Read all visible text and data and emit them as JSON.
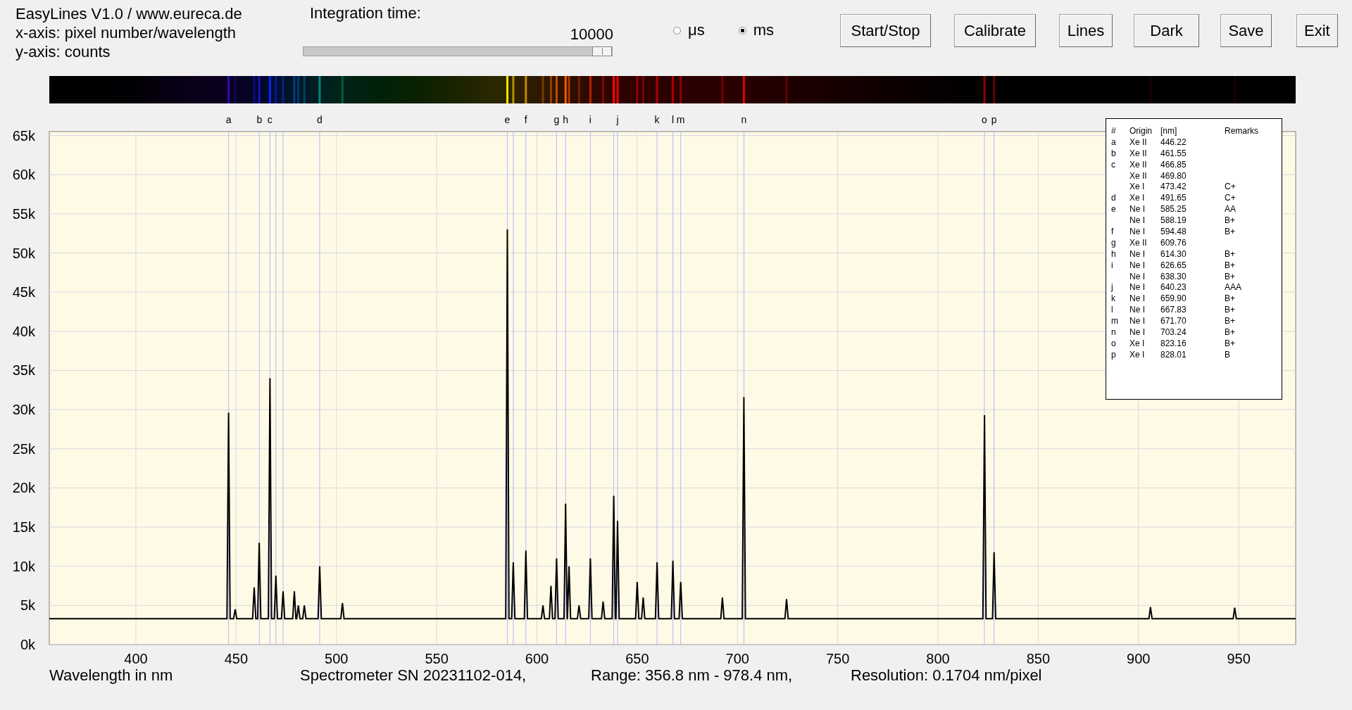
{
  "header": {
    "info_lines": [
      "EasyLines V1.0 / www.eureca.de",
      "x-axis: pixel number/wavelength",
      "y-axis: counts"
    ],
    "integration": {
      "label": "Integration time:",
      "value": "10000",
      "level": 1.0
    },
    "units": [
      {
        "label": "μs",
        "selected": false
      },
      {
        "label": "ms",
        "selected": true
      }
    ],
    "buttons": [
      "Start/Stop",
      "Calibrate",
      "Lines",
      "Dark",
      "Save",
      "Exit"
    ]
  },
  "chart_data": {
    "type": "line",
    "xlabel": "Wavelength in nm",
    "xlim": [
      356.8,
      978.4
    ],
    "ylim": [
      0,
      65500
    ],
    "xticks": [
      400,
      450,
      500,
      550,
      600,
      650,
      700,
      750,
      800,
      850,
      900,
      950
    ],
    "yticks": [
      {
        "value": 0,
        "label": "0k"
      },
      {
        "value": 5000,
        "label": "5k"
      },
      {
        "value": 10000,
        "label": "10k"
      },
      {
        "value": 15000,
        "label": "15k"
      },
      {
        "value": 20000,
        "label": "20k"
      },
      {
        "value": 25000,
        "label": "25k"
      },
      {
        "value": 30000,
        "label": "30k"
      },
      {
        "value": 35000,
        "label": "35k"
      },
      {
        "value": 40000,
        "label": "40k"
      },
      {
        "value": 45000,
        "label": "45k"
      },
      {
        "value": 50000,
        "label": "50k"
      },
      {
        "value": 55000,
        "label": "55k"
      },
      {
        "value": 60000,
        "label": "60k"
      },
      {
        "value": 65000,
        "label": "65k"
      }
    ],
    "x": [
      356.8,
      445.4,
      446.2,
      447.0,
      448.7,
      449.5,
      450.3,
      458.2,
      459.0,
      459.8,
      460.7,
      461.5,
      462.3,
      466.05,
      466.85,
      467.65,
      469.0,
      469.8,
      470.6,
      472.6,
      473.4,
      474.2,
      478.2,
      479.0,
      479.8,
      480.2,
      481.0,
      481.8,
      483.2,
      484.0,
      484.8,
      490.85,
      491.65,
      492.45,
      502.2,
      503.0,
      503.8,
      584.45,
      585.25,
      586.05,
      587.4,
      588.2,
      589.0,
      593.7,
      594.5,
      595.3,
      602.2,
      603.0,
      603.8,
      606.2,
      607.0,
      607.8,
      609.0,
      609.8,
      610.6,
      613.5,
      614.3,
      615.1,
      615.2,
      616.0,
      616.8,
      620.2,
      621.0,
      621.8,
      625.85,
      626.65,
      627.45,
      632.2,
      633.0,
      633.8,
      637.5,
      638.3,
      639.1,
      639.4,
      640.2,
      641.0,
      649.2,
      650.0,
      650.8,
      652.2,
      653.0,
      653.8,
      659.1,
      659.9,
      660.7,
      667.0,
      667.8,
      668.6,
      670.9,
      671.7,
      672.5,
      691.7,
      692.5,
      693.3,
      702.4,
      703.2,
      704.0,
      723.7,
      724.5,
      725.3,
      822.4,
      823.2,
      824.0,
      827.2,
      828.0,
      828.8,
      905.2,
      906.0,
      906.8,
      947.2,
      948.0,
      948.8,
      978.4
    ],
    "series": [
      {
        "color": "#000000",
        "values": [
          3300,
          3300,
          29600,
          3300,
          3300,
          4500,
          3300,
          3300,
          7300,
          3300,
          3300,
          13000,
          3300,
          3300,
          34000,
          3300,
          3300,
          8800,
          3300,
          3300,
          6800,
          3300,
          3300,
          6800,
          3300,
          3300,
          5000,
          3300,
          3300,
          5000,
          3300,
          3300,
          10000,
          3300,
          3300,
          5300,
          3300,
          3300,
          53000,
          3300,
          3300,
          10500,
          3300,
          3300,
          12000,
          3300,
          3300,
          5000,
          3300,
          3300,
          7500,
          3300,
          3300,
          11000,
          3300,
          3300,
          18000,
          3300,
          3300,
          10000,
          3300,
          3300,
          5000,
          3300,
          3300,
          11000,
          3300,
          3300,
          5500,
          3300,
          3300,
          19000,
          3300,
          3300,
          15800,
          3300,
          3300,
          8000,
          3300,
          3300,
          6000,
          3300,
          3300,
          10500,
          3300,
          3300,
          10700,
          3300,
          3300,
          8000,
          3300,
          3300,
          6000,
          3300,
          3300,
          31600,
          3300,
          3300,
          5800,
          3300,
          3300,
          29300,
          3300,
          3300,
          11800,
          3300,
          3300,
          4800,
          3300,
          3300,
          4700,
          3300,
          3300
        ]
      }
    ],
    "grid": true,
    "ref_lines": [
      {
        "axis": "x",
        "value": 469.8
      },
      {
        "axis": "x",
        "value": 473.42
      },
      {
        "axis": "x",
        "value": 588.19
      },
      {
        "axis": "x",
        "value": 638.3
      }
    ],
    "annotations": [
      {
        "x": 446.22,
        "text": "a"
      },
      {
        "x": 461.55,
        "text": "b"
      },
      {
        "x": 466.85,
        "text": "c"
      },
      {
        "x": 491.65,
        "text": "d"
      },
      {
        "x": 585.25,
        "text": "e"
      },
      {
        "x": 594.48,
        "text": "f"
      },
      {
        "x": 609.76,
        "text": "g"
      },
      {
        "x": 614.3,
        "text": "h"
      },
      {
        "x": 626.65,
        "text": "i"
      },
      {
        "x": 640.23,
        "text": "j"
      },
      {
        "x": 659.9,
        "text": "k"
      },
      {
        "x": 667.83,
        "text": "l"
      },
      {
        "x": 671.7,
        "text": "m"
      },
      {
        "x": 703.24,
        "text": "n"
      },
      {
        "x": 823.16,
        "text": "o"
      },
      {
        "x": 828.01,
        "text": "p"
      }
    ]
  },
  "legend": {
    "columns": [
      "#",
      "Origin",
      "[nm]",
      "Remarks"
    ],
    "rows": [
      {
        "id": "a",
        "origin": "Xe II",
        "nm": "446.22"
      },
      {
        "id": "b",
        "origin": "Xe II",
        "nm": "461.55"
      },
      {
        "id": "c",
        "origin": "Xe II",
        "nm": "466.85"
      },
      {
        "origin": "Xe II",
        "nm": "469.80"
      },
      {
        "origin": "Xe I",
        "nm": "473.42",
        "remarks": "C+"
      },
      {
        "id": "d",
        "origin": "Xe I",
        "nm": "491.65",
        "remarks": "C+"
      },
      {
        "id": "e",
        "origin": "Ne I",
        "nm": "585.25",
        "remarks": "AA"
      },
      {
        "origin": "Ne I",
        "nm": "588.19",
        "remarks": "B+"
      },
      {
        "id": "f",
        "origin": "Ne I",
        "nm": "594.48",
        "remarks": "B+"
      },
      {
        "id": "g",
        "origin": "Xe II",
        "nm": "609.76"
      },
      {
        "id": "h",
        "origin": "Ne I",
        "nm": "614.30",
        "remarks": "B+"
      },
      {
        "id": "i",
        "origin": "Ne I",
        "nm": "626.65",
        "remarks": "B+"
      },
      {
        "origin": "Ne I",
        "nm": "638.30",
        "remarks": "B+"
      },
      {
        "id": "j",
        "origin": "Ne I",
        "nm": "640.23",
        "remarks": "AAA"
      },
      {
        "id": "k",
        "origin": "Ne I",
        "nm": "659.90",
        "remarks": "B+"
      },
      {
        "id": "l",
        "origin": "Ne I",
        "nm": "667.83",
        "remarks": "B+"
      },
      {
        "id": "m",
        "origin": "Ne I",
        "nm": "671.70",
        "remarks": "B+"
      },
      {
        "id": "n",
        "origin": "Ne I",
        "nm": "703.24",
        "remarks": "B+"
      },
      {
        "id": "o",
        "origin": "Xe I",
        "nm": "823.16",
        "remarks": "B+"
      },
      {
        "id": "p",
        "origin": "Xe I",
        "nm": "828.01",
        "remarks": "B"
      }
    ]
  },
  "footer": [
    "Spectrometer SN 20231102-014,",
    "Range: 356.8 nm - 978.4 nm,",
    "Resolution: 0.1704 nm/pixel"
  ]
}
